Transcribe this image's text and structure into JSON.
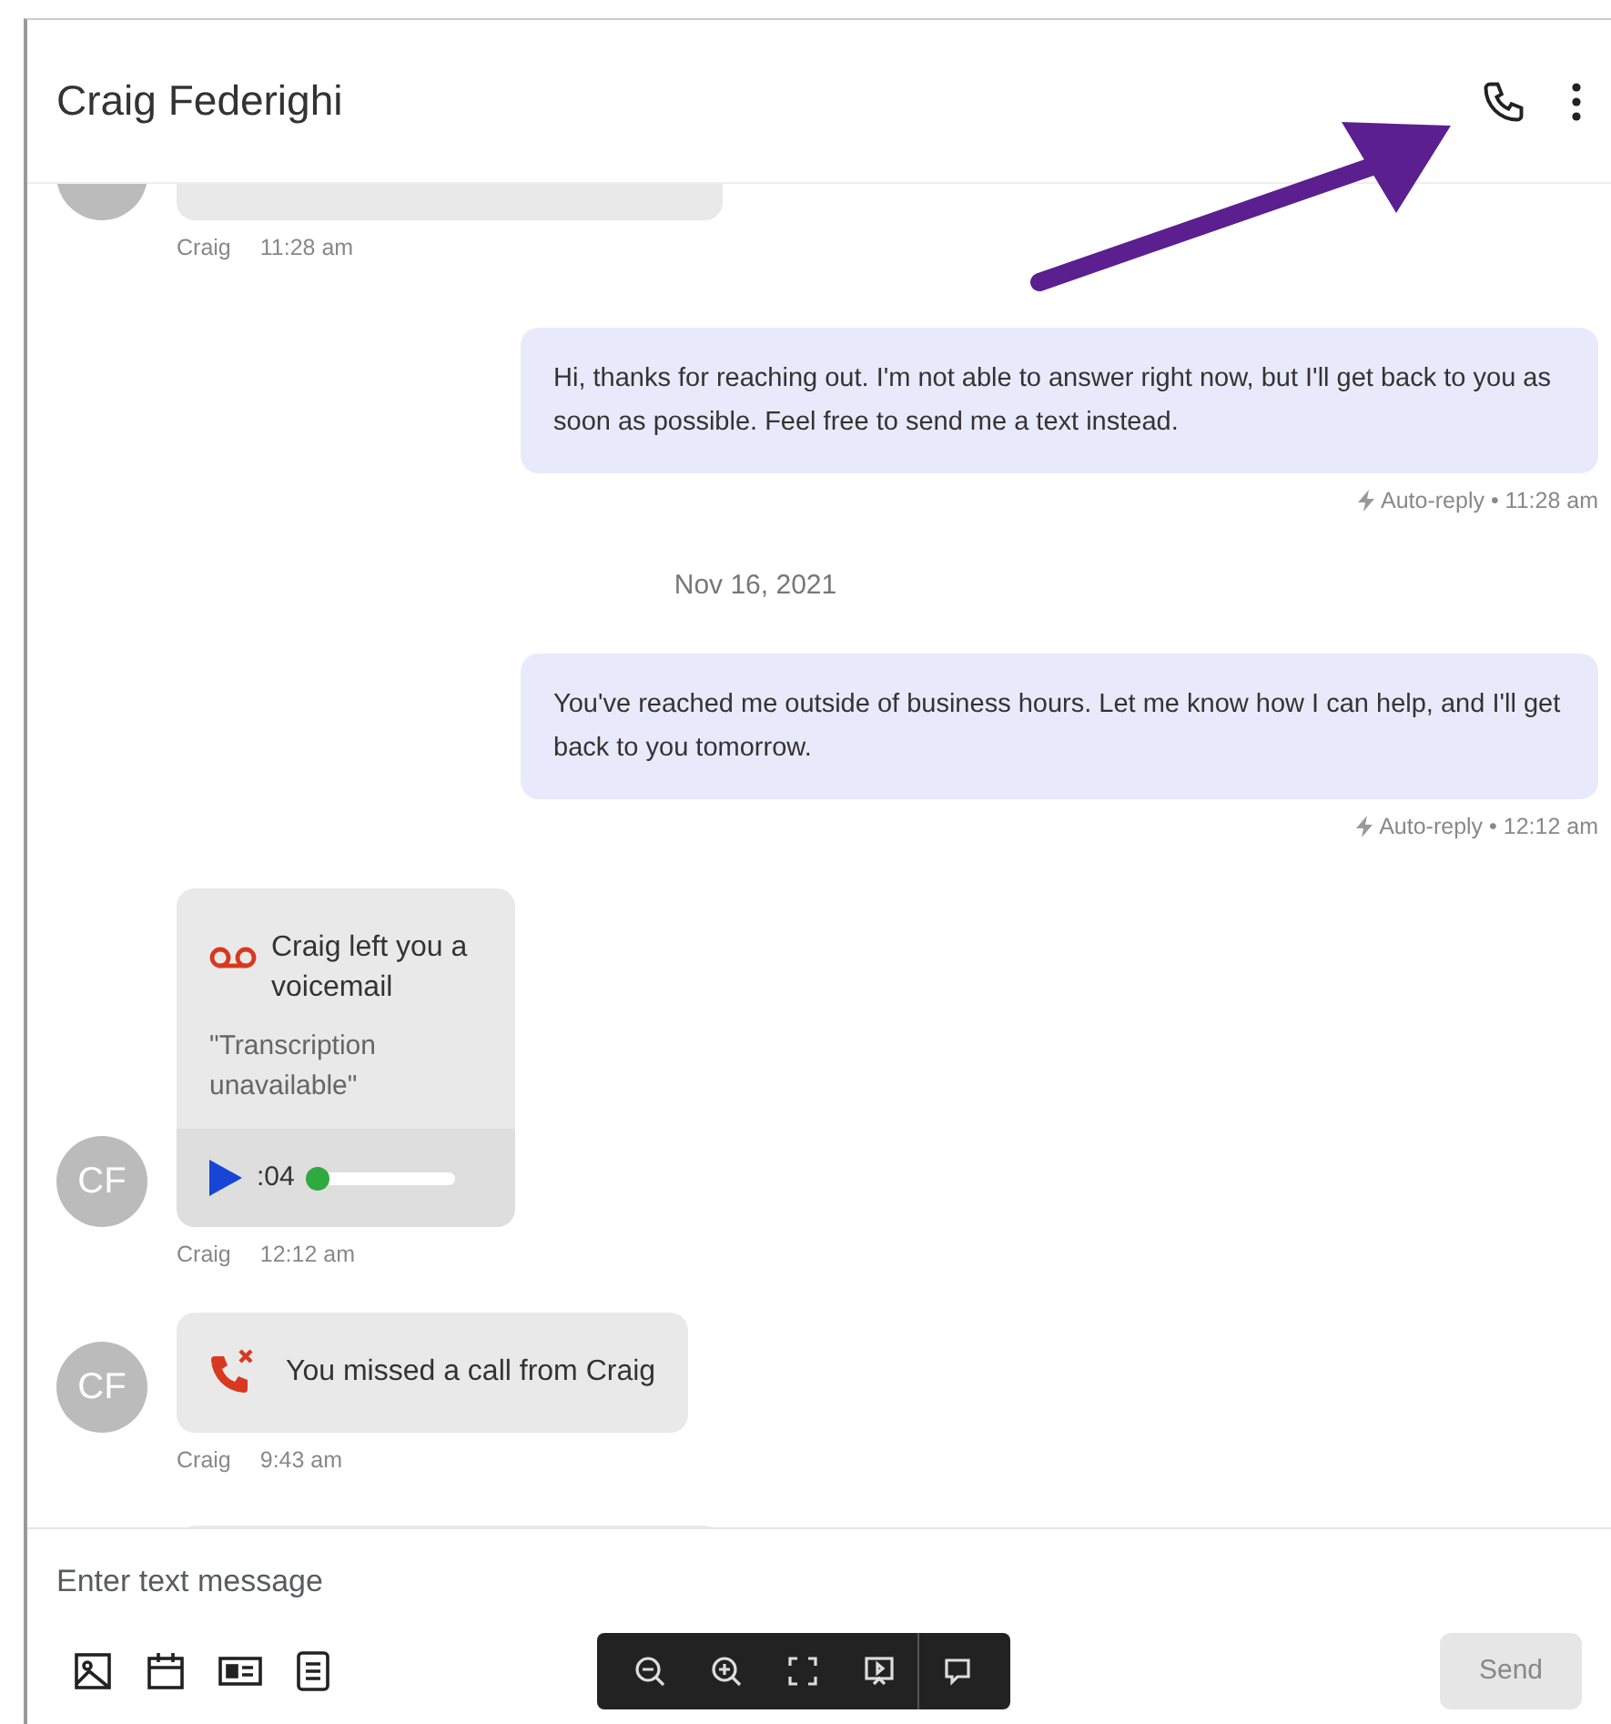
{
  "header": {
    "title": "Craig Federighi"
  },
  "messages": [
    {
      "kind": "clipped",
      "sender": "Craig",
      "time": "11:28 am"
    },
    {
      "kind": "outgoing",
      "text": "Hi, thanks for reaching out. I'm not able to answer right now, but I'll get back to you as soon as possible. Feel free to send me a text instead.",
      "meta": "Auto-reply • 11:28 am"
    },
    {
      "kind": "date",
      "text": "Nov 16, 2021"
    },
    {
      "kind": "outgoing",
      "text": "You've reached me outside of business hours. Let me know how I can help, and I'll get back to you tomorrow.",
      "meta": "Auto-reply • 12:12 am"
    },
    {
      "kind": "voicemail",
      "avatar": "CF",
      "title": "Craig left you a voicemail",
      "transcription": "\"Transcription unavailable\"",
      "duration": ":04",
      "level": 0.05,
      "sender": "Craig",
      "time": "12:12 am"
    },
    {
      "kind": "missed_call",
      "avatar": "CF",
      "text": "You missed a call from Craig",
      "sender": "Craig",
      "time": "9:43 am"
    }
  ],
  "composer": {
    "placeholder": "Enter text message",
    "send": {
      "label": "Send",
      "disabled": true
    }
  }
}
